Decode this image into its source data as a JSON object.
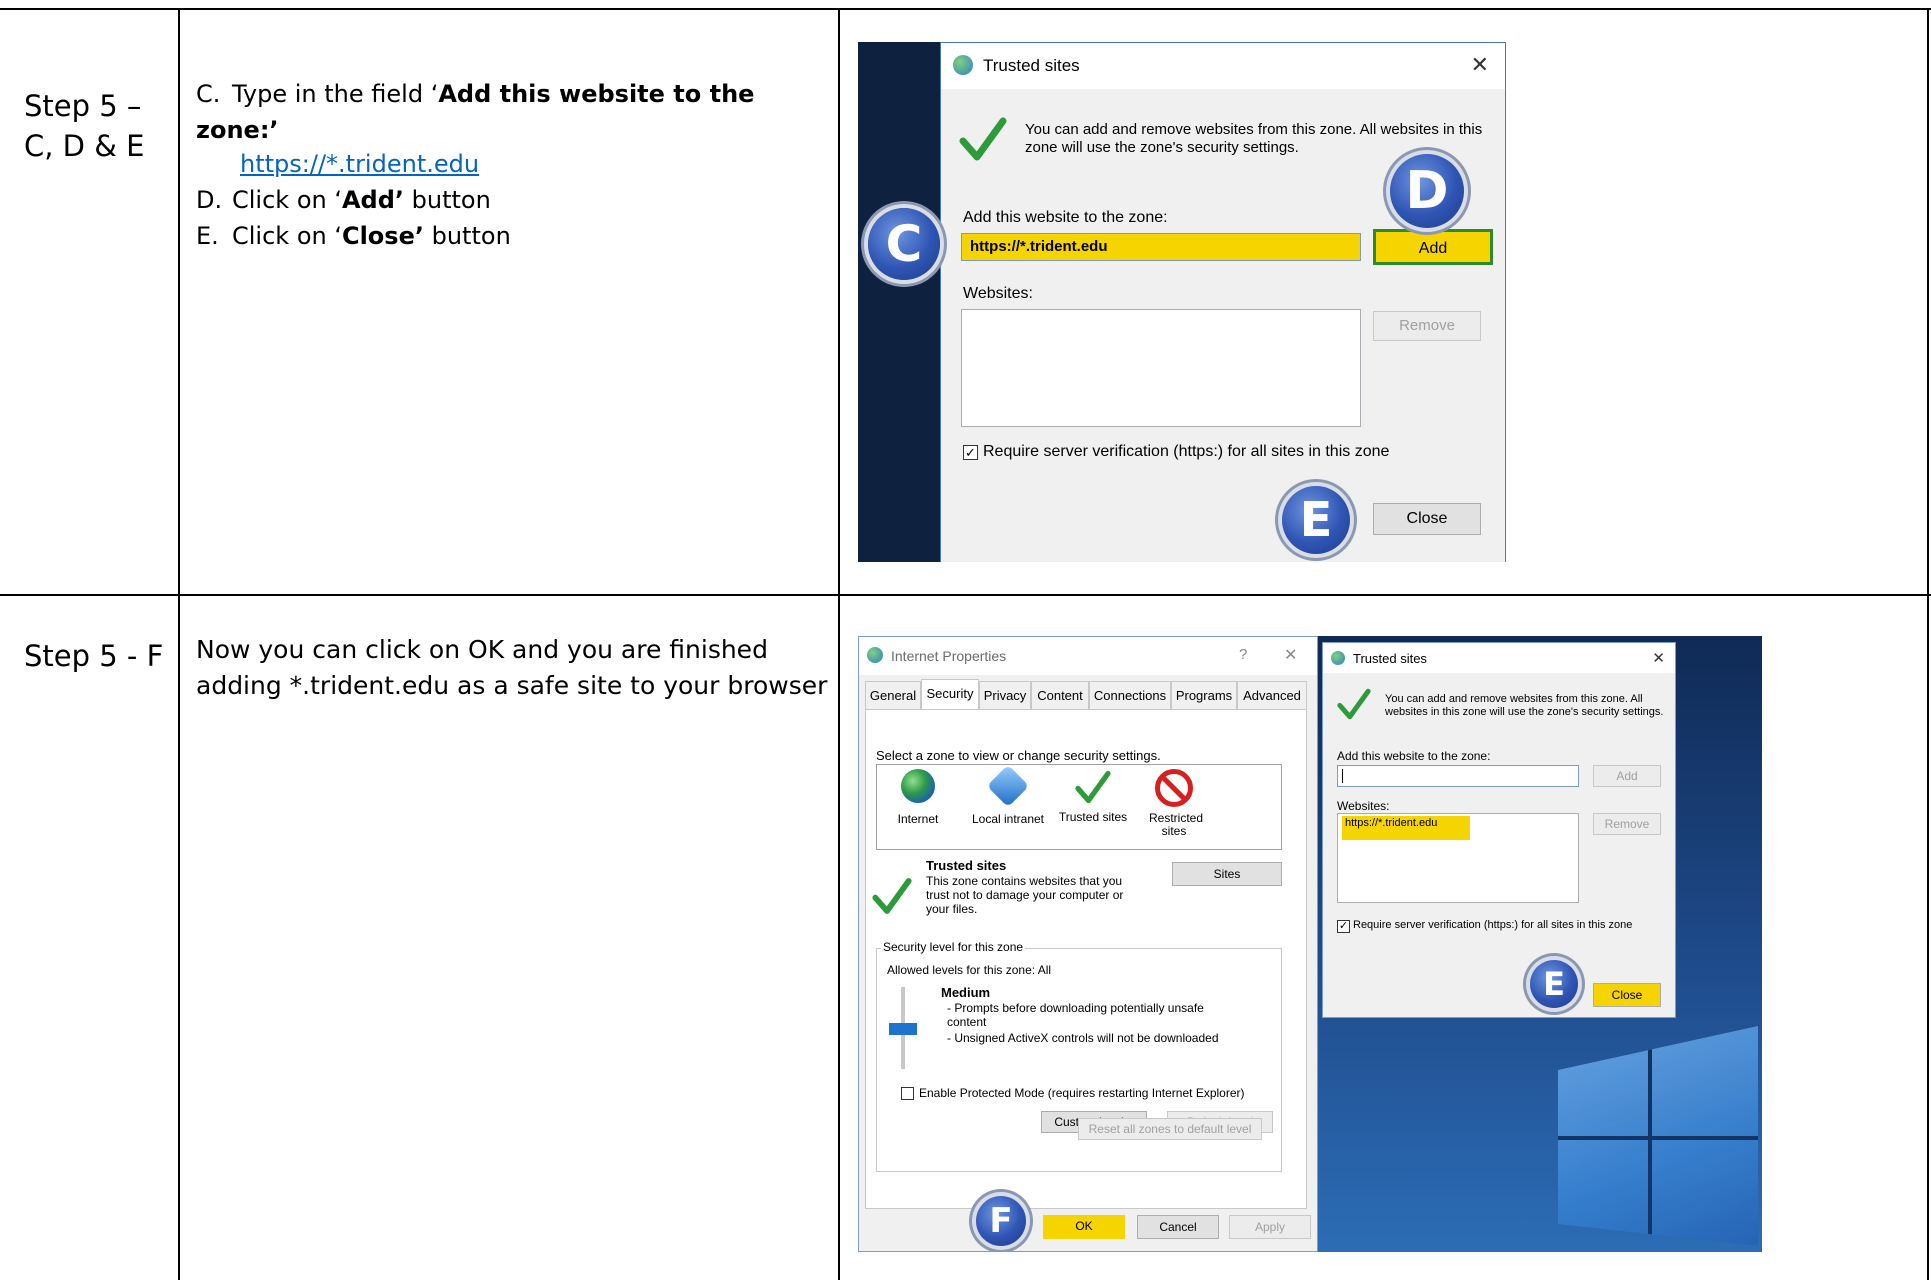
{
  "row1": {
    "step": "Step 5 –\nC, D & E",
    "instructions": [
      {
        "letter": "C.",
        "before": "Type in the field ‘",
        "bold": "Add this website to the zone:’",
        "after": "",
        "link": "https://*.trident.edu"
      },
      {
        "letter": "D.",
        "before": "Click on ‘",
        "bold": "Add’",
        "after": " button"
      },
      {
        "letter": "E.",
        "before": "Click on ‘",
        "bold": "Close’",
        "after": " button"
      }
    ],
    "dialog": {
      "title": "Trusted sites",
      "close_glyph": "✕",
      "info": "You can add and remove websites from this zone. All websites in this zone will use the zone's security settings.",
      "add_label": "Add this website to the zone:",
      "add_value": "https://*.trident.edu",
      "add_button": "Add",
      "websites_label": "Websites:",
      "remove_button": "Remove",
      "require_label": "Require server verification (https:) for all sites in this zone",
      "close_button": "Close",
      "badges": [
        "C",
        "D",
        "E"
      ]
    }
  },
  "row2": {
    "step": "Step 5 - F",
    "text": "Now you can click on OK and you are finished adding *.trident.edu as a safe site to your browser",
    "inet": {
      "title": "Internet Properties",
      "help_glyph": "?",
      "close_glyph": "✕",
      "tabs": [
        "General",
        "Security",
        "Privacy",
        "Content",
        "Connections",
        "Programs",
        "Advanced"
      ],
      "select_zone": "Select a zone to view or change security settings.",
      "zones": [
        "Internet",
        "Local intranet",
        "Trusted sites",
        "Restricted sites"
      ],
      "zone_title": "Trusted sites",
      "zone_desc": "This zone contains websites that you trust not to damage your computer or your files.",
      "sites_button": "Sites",
      "security_level": "Security level for this zone",
      "allowed": "Allowed levels for this zone: All",
      "level_name": "Medium",
      "level_desc1": "- Prompts before downloading potentially unsafe content",
      "level_desc2": "- Unsigned ActiveX controls will not be downloaded",
      "protected_mode": "Enable Protected Mode (requires restarting Internet Explorer)",
      "custom_level": "Custom level...",
      "default_level": "Default level",
      "reset_all": "Reset all zones to default level",
      "ok": "OK",
      "cancel": "Cancel",
      "apply": "Apply",
      "badge": "F"
    },
    "trusted": {
      "title": "Trusted sites",
      "close_glyph": "✕",
      "info": "You can add and remove websites from this zone. All websites in this zone will use the zone's security settings.",
      "add_label": "Add this website to the zone:",
      "add_button": "Add",
      "websites_label": "Websites:",
      "website_entry": "https://*.trident.edu",
      "remove_button": "Remove",
      "require_label": "Require server verification (https:) for all sites in this zone",
      "close_button": "Close",
      "badge": "E"
    }
  },
  "colors": {
    "highlight": "#f5d400",
    "badge": "#2f55b4",
    "link": "#0563c1",
    "desktop": "#1a3a6a"
  }
}
